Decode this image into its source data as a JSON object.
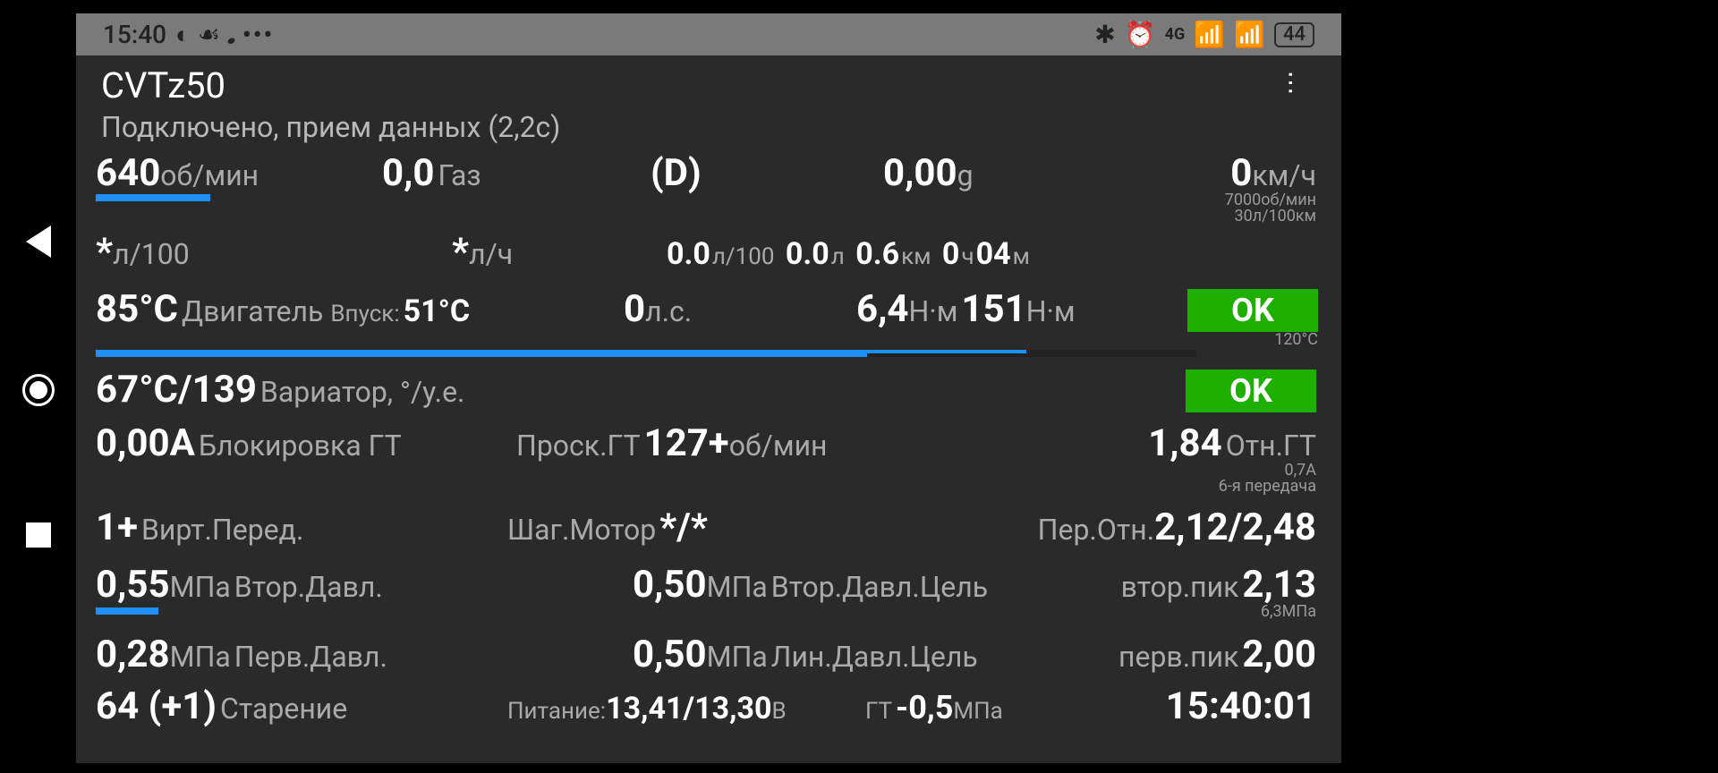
{
  "status": {
    "time": "15:40",
    "net": "4G",
    "battery": "44"
  },
  "app": {
    "title": "CVTz50",
    "subtitle": "Подключено, прием данных (2,2с)"
  },
  "row1": {
    "rpm_v": "640",
    "rpm_u": "об/мин",
    "gas_v": "0,0",
    "gas_u": "Газ",
    "gear": "(D)",
    "g_v": "0,00",
    "g_u": "g",
    "speed_v": "0",
    "speed_u": "км/ч",
    "sub1": "7000об/мин",
    "sub2": "30л/100км"
  },
  "row2": {
    "c1": "*",
    "c1u": "л/100",
    "c2": "*",
    "c2u": "л/ч",
    "m1v": "0.0",
    "m1u": "л/100",
    "m2v": "0.0",
    "m2u": "л",
    "m3v": "0.6",
    "m3u": "км",
    "m4v": "0",
    "m4u": "ч",
    "m5v": "04",
    "m5u": "м"
  },
  "row3": {
    "temp_v": "85°C",
    "temp_l": "Двигатель",
    "intake_l": "Впуск:",
    "intake_v": "51°C",
    "hp_v": "0",
    "hp_u": "л.с.",
    "nm1_v": "6,4",
    "nm1_u": "Н·м",
    "nm2_v": "151",
    "nm2_u": "Н·м",
    "ok": "OK",
    "sub": "120°C"
  },
  "row4": {
    "v": "67°C/139",
    "l": "Вариатор, °/у.е.",
    "ok": "OK"
  },
  "row5": {
    "a_v": "0,00A",
    "a_l": "Блокировка ГТ",
    "slip_l": "Проск.ГТ",
    "slip_v": "127+",
    "slip_u": "об/мин",
    "ratio_v": "1,84",
    "ratio_l": "Отн.ГТ",
    "sub1": "0,7А",
    "sub2": "6-я передача"
  },
  "row6": {
    "g_v": "1+",
    "g_l": "Вирт.Перед.",
    "sm_l": "Шаг.Мотор",
    "sm_v": "*/*",
    "r_l": "Пер.Отн.",
    "r_v": "2,12/2,48"
  },
  "row7": {
    "p_v": "0,55",
    "p_u": "МПа",
    "p_l": "Втор.Давл.",
    "t_v": "0,50",
    "t_u": "МПа",
    "t_l": "Втор.Давл.Цель",
    "pk_l": "втор.пик",
    "pk_v": "2,13",
    "sub": "6,3МПа"
  },
  "row8": {
    "p_v": "0,28",
    "p_u": "МПа",
    "p_l": "Перв.Давл.",
    "t_v": "0,50",
    "t_u": "МПа",
    "t_l": "Лин.Давл.Цель",
    "pk_l": "перв.пик",
    "pk_v": "2,00"
  },
  "row9": {
    "a_v": "64 (+1)",
    "a_l": "Старение",
    "pw_l": "Питание:",
    "pw_v": "13,41/13,30",
    "pw_u": "В",
    "gt_l": "ГТ",
    "gt_v": "-0,5",
    "gt_u": "МПа",
    "clock": "15:40:01"
  }
}
